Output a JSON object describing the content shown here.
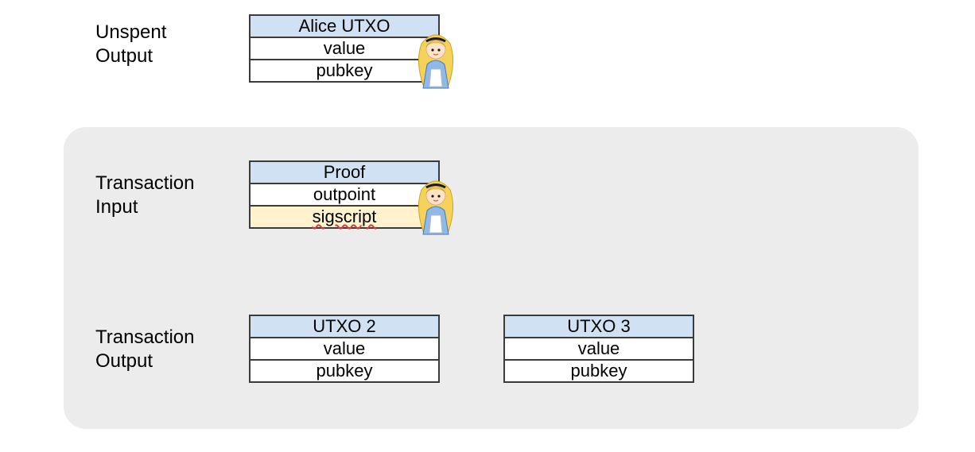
{
  "labels": {
    "unspent_output_l1": "Unspent",
    "unspent_output_l2": "Output",
    "tx_input_l1": "Transaction",
    "tx_input_l2": "Input",
    "tx_output_l1": "Transaction",
    "tx_output_l2": "Output"
  },
  "utxo_alice": {
    "header": "Alice UTXO",
    "row1": "value",
    "row2": "pubkey"
  },
  "proof": {
    "header": "Proof",
    "row1": "outpoint",
    "row2": "sigscript"
  },
  "utxo2": {
    "header": "UTXO 2",
    "row1": "value",
    "row2": "pubkey"
  },
  "utxo3": {
    "header": "UTXO 3",
    "row1": "value",
    "row2": "pubkey"
  },
  "colors": {
    "header_bg": "#cfe1f3",
    "highlight_bg": "#fff2cc",
    "panel_bg": "#ececec",
    "border": "#3b3b3b"
  },
  "actors": {
    "alice": "Alice"
  }
}
